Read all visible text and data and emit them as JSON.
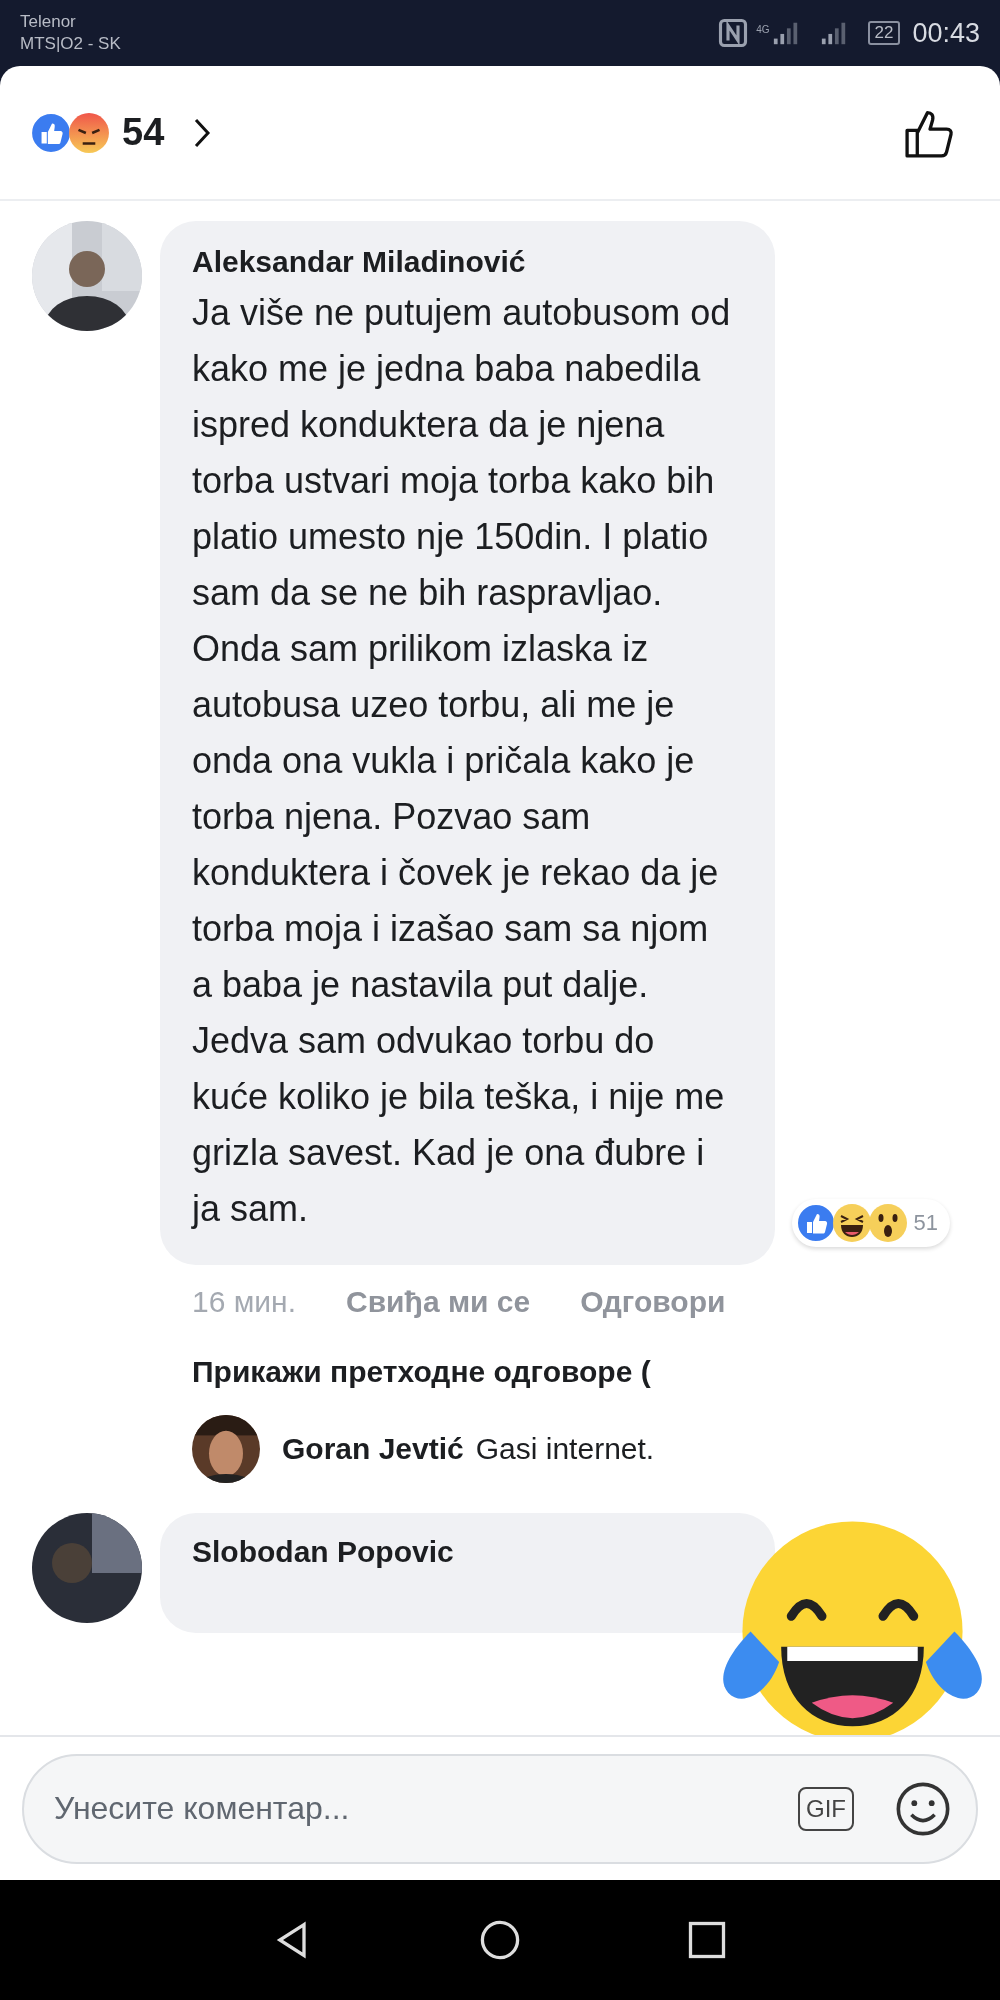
{
  "status_bar": {
    "carriers": [
      "Telenor",
      "MTS|O2 - SK"
    ],
    "network": "4G",
    "battery": "22",
    "time": "00:43"
  },
  "reactions_header": {
    "count": "54"
  },
  "comment": {
    "author": "Aleksandar Miladinović",
    "text": "Ja više ne putujem autobusom od kako me je jedna baba nabedila ispred konduktera da je njena torba ustvari moja torba kako bih platio umesto nje 150din. I platio sam da se ne bih raspravljao. Onda sam prilikom izlaska iz autobusa uzeo torbu, ali me je onda ona vukla i pričala kako je torba njena. Pozvao sam konduktera i čovek je rekao da je torba moja i izašao sam sa njom a baba je nastavila put dalje. Jedva sam odvukao torbu do kuće koliko je bila teška, i nije me grizla savest. Kad je ona đubre i ja sam.",
    "reaction_count": "51",
    "time": "16 мин.",
    "actions": [
      "Свиђа ми се",
      "Одговори"
    ]
  },
  "previous_replies": "Прикажи претходне одговоре (",
  "reply": {
    "author": "Goran Jevtić",
    "text": "Gasi internet."
  },
  "next_comment": {
    "author": "Slobodan Popovic"
  },
  "composer": {
    "placeholder": "Унесите коментар...",
    "gif": "GIF"
  }
}
